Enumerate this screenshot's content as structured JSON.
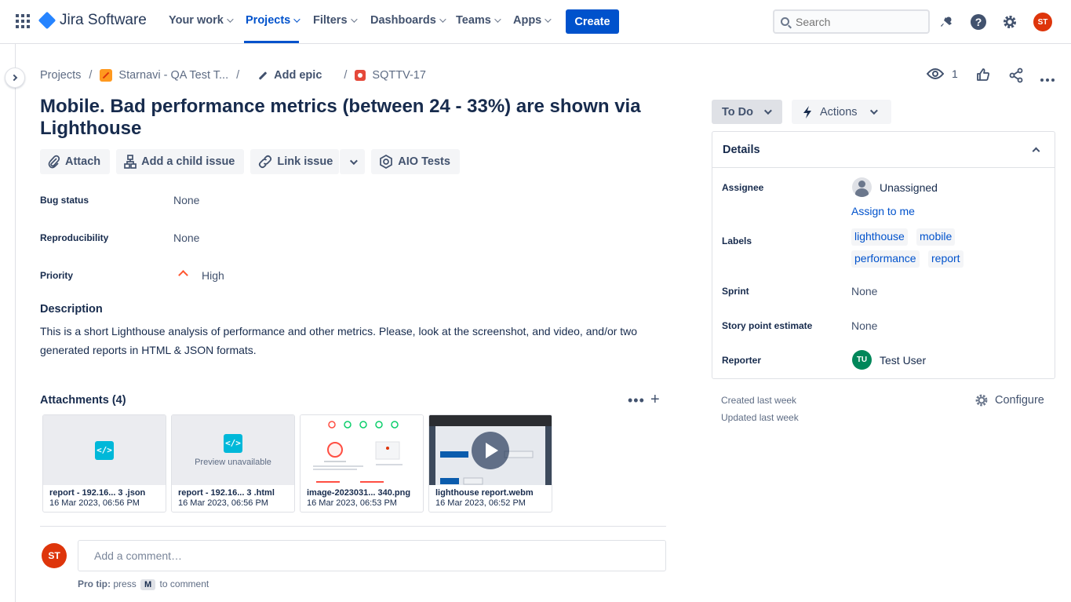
{
  "nav": {
    "logo": "Jira Software",
    "items": [
      {
        "label": "Your work"
      },
      {
        "label": "Projects"
      },
      {
        "label": "Filters"
      },
      {
        "label": "Dashboards"
      },
      {
        "label": "Teams"
      },
      {
        "label": "Apps"
      }
    ],
    "active": "Projects",
    "create_label": "Create",
    "search_placeholder": "Search",
    "user_initials": "ST"
  },
  "breadcrumb": {
    "projects": "Projects",
    "project_name": "Starnavi - QA Test T...",
    "add_epic": "Add epic",
    "issue_key": "SQTTV-17"
  },
  "issue": {
    "title": "Mobile. Bad performance metrics (between 24 - 33%) are shown via Lighthouse",
    "actions": {
      "attach": "Attach",
      "add_child": "Add a child issue",
      "link_issue": "Link issue",
      "aio_tests": "AIO Tests"
    },
    "fields": {
      "bug_status_label": "Bug status",
      "bug_status_value": "None",
      "reproducibility_label": "Reproducibility",
      "reproducibility_value": "None",
      "priority_label": "Priority",
      "priority_value": "High"
    },
    "description_heading": "Description",
    "description": "This is a short Lighthouse analysis of performance and other metrics. Please, look at the screenshot, and video, and/or two generated reports in HTML & JSON formats."
  },
  "attachments": {
    "heading": "Attachments (4)",
    "items": [
      {
        "name": "report - 192.16... 3 .json",
        "date": "16 Mar 2023, 06:56 PM",
        "kind": "code"
      },
      {
        "name": "report - 192.16... 3 .html",
        "date": "16 Mar 2023, 06:56 PM",
        "kind": "code",
        "preview_text": "Preview unavailable"
      },
      {
        "name": "image-2023031... 340.png",
        "date": "16 Mar 2023, 06:53 PM",
        "kind": "image"
      },
      {
        "name": "lighthouse report.webm",
        "date": "16 Mar 2023, 06:52 PM",
        "kind": "video"
      }
    ]
  },
  "comment": {
    "avatar_initials": "ST",
    "placeholder": "Add a comment…",
    "protip_bold": "Pro tip:",
    "protip_press": "press",
    "protip_key": "M",
    "protip_rest": "to comment"
  },
  "header_actions": {
    "watch_count": "1"
  },
  "status": {
    "label": "To Do",
    "actions_label": "Actions"
  },
  "details": {
    "heading": "Details",
    "assignee_label": "Assignee",
    "assignee_value": "Unassigned",
    "assign_to_me": "Assign to me",
    "labels_label": "Labels",
    "labels": [
      "lighthouse",
      "mobile",
      "performance",
      "report"
    ],
    "sprint_label": "Sprint",
    "sprint_value": "None",
    "story_points_label": "Story point estimate",
    "story_points_value": "None",
    "reporter_label": "Reporter",
    "reporter_value": "Test User",
    "reporter_initials": "TU"
  },
  "meta": {
    "created": "Created last week",
    "updated": "Updated last week",
    "configure": "Configure"
  },
  "colors": {
    "brand": "#0052cc",
    "priority_high": "#ff5630",
    "avatar_user": "#de350b",
    "avatar_reporter": "#00875a"
  }
}
